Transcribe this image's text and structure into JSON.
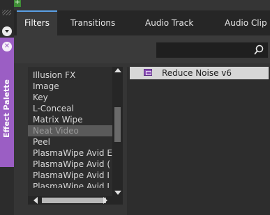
{
  "window": {
    "close_glyph": "×",
    "max_glyph": "+"
  },
  "sidebar": {
    "panel_label": "Effect Palette",
    "close_glyph": "✕"
  },
  "tabs": [
    {
      "label": "Filters",
      "active": true
    },
    {
      "label": "Transitions",
      "active": false
    },
    {
      "label": "Audio Track",
      "active": false
    },
    {
      "label": "Audio Clip",
      "active": false
    }
  ],
  "search": {
    "value": "",
    "icon": "search-icon"
  },
  "categories": [
    {
      "label": "Illusion FX",
      "selected": false
    },
    {
      "label": "Image",
      "selected": false
    },
    {
      "label": "Key",
      "selected": false
    },
    {
      "label": "L-Conceal",
      "selected": false
    },
    {
      "label": "Matrix Wipe",
      "selected": false
    },
    {
      "label": "Neat Video",
      "selected": true
    },
    {
      "label": "Peel",
      "selected": false
    },
    {
      "label": "PlasmaWipe Avid E",
      "selected": false
    },
    {
      "label": "PlasmaWipe Avid (",
      "selected": false
    },
    {
      "label": "PlasmaWipe Avid I",
      "selected": false
    },
    {
      "label": "PlasmaWipe Avid I",
      "selected": false
    }
  ],
  "effects": [
    {
      "label": "Reduce Noise v6",
      "icon": "effect-icon",
      "selected": true
    }
  ],
  "colors": {
    "accent_tab": "#5aa0e6",
    "effect_palette": "#9b5ec4",
    "close_button": "#b8332b",
    "minimize_button": "#c9a23a",
    "maximize_button": "#3f8d36"
  }
}
